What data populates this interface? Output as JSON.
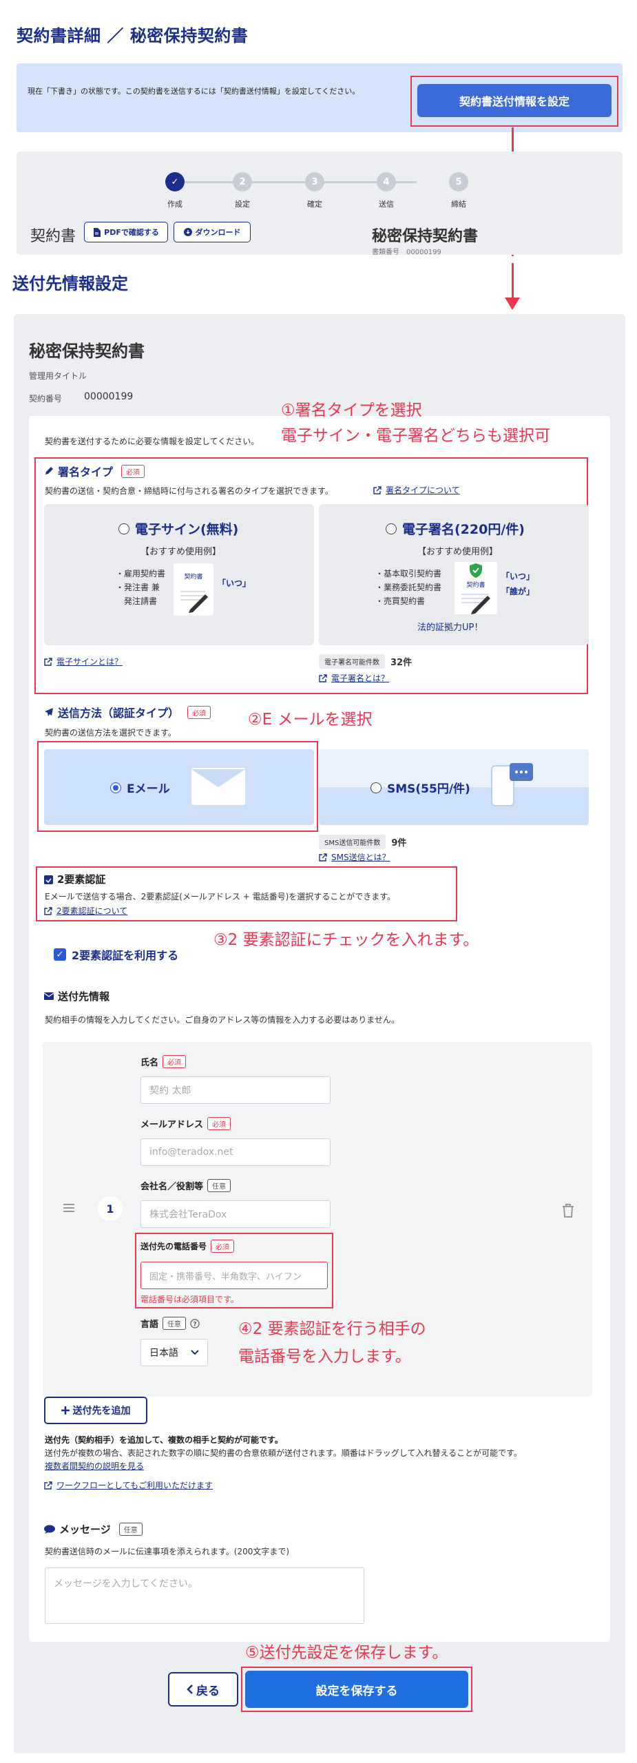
{
  "header": {
    "title": "契約書詳細 ／ 秘密保持契約書",
    "notice": "現在「下書き」の状態です。この契約書を送信するには「契約書送付情報」を設定してください。",
    "notice_button": "契約書送付情報を設定"
  },
  "progress": {
    "steps": [
      {
        "num": "✓",
        "label": "作成"
      },
      {
        "num": "2",
        "label": "設定"
      },
      {
        "num": "3",
        "label": "確定"
      },
      {
        "num": "4",
        "label": "送信"
      },
      {
        "num": "5",
        "label": "締結"
      }
    ],
    "doc_label": "契約書",
    "pdf_button": "PDFで確認する",
    "download_button": "ダウンロード",
    "doc_title": "秘密保持契約書",
    "doc_number_partial": "書類番号　00000199"
  },
  "section_title": "送付先情報設定",
  "contract": {
    "title": "秘密保持契約書",
    "mgmt_title_label": "管理用タイトル",
    "number_label": "契約番号",
    "number": "00000199",
    "intro": "契約書を送付するために必要な情報を設定してください。"
  },
  "annotations": {
    "a1_line1": "①署名タイプを選択",
    "a1_line2": "電子サイン・電子署名どちらも選択可",
    "a2": "②E メールを選択",
    "a3": "③2 要素認証にチェックを入れます。",
    "a4_line1": "④2 要素認証を行う相手の",
    "a4_line2": "電話番号を入力します。",
    "a5": "⑤送付先設定を保存します。"
  },
  "signature": {
    "title": "署名タイプ",
    "required": "必須",
    "desc": "契約書の送信・契約合意・締結時に付与される署名のタイプを選択できます。",
    "about_link": "署名タイプについて",
    "esign": {
      "title": "電子サイン(無料)",
      "rec": "【おすすめ使用例】",
      "items": [
        "・雇用契約書",
        "・発注書 兼",
        "　発注請書"
      ],
      "doc_text": "契約書",
      "when": "「いつ」",
      "link": "電子サインとは？"
    },
    "edsig": {
      "title": "電子署名(220円/件)",
      "rec": "【おすすめ使用例】",
      "items": [
        "・基本取引契約書",
        "・業務委託契約書",
        "・売買契約書"
      ],
      "doc_text": "契約書",
      "when": "「いつ」",
      "who": "「誰が」",
      "badge": "法的証拠力UP！",
      "count_label": "電子署名可能件数",
      "count": "32件",
      "link": "電子署名とは？"
    }
  },
  "send_method": {
    "title": "送信方法（認証タイプ）",
    "required": "必須",
    "desc": "契約書の送信方法を選択できます。",
    "email": "Eメール",
    "sms": "SMS(55円/件)",
    "sms_count_label": "SMS送信可能件数",
    "sms_count": "9件",
    "sms_link": "SMS送信とは？"
  },
  "two_factor": {
    "title": "2要素認証",
    "desc": "Eメールで送信する場合、2要素認証(メールアドレス + 電話番号)を選択することができます。",
    "link": "2要素認証について",
    "checkbox_label": "2要素認証を利用する"
  },
  "recipient": {
    "title": "送付先情報",
    "desc": "契約相手の情報を入力してください。ご自身のアドレス等の情報を入力する必要はありません。",
    "index": "1",
    "name_label": "氏名",
    "name_placeholder": "契約 太郎",
    "email_label": "メールアドレス",
    "email_placeholder": "info@teradox.net",
    "company_label": "会社名／役割等",
    "company_placeholder": "株式会社TeraDox",
    "phone_label": "送付先の電話番号",
    "phone_placeholder": "固定・携帯番号、半角数字、ハイフン",
    "phone_error": "電話番号は必須項目です。",
    "lang_label": "言語",
    "lang_value": "日本語",
    "required": "必須",
    "optional": "任意"
  },
  "add_recipient": {
    "button": "送付先を追加",
    "note1": "送付先（契約相手）を追加して、複数の相手と契約が可能です。",
    "note2": "送付先が複数の場合、表記された数字の順に契約書の合意依頼が送付されます。順番はドラッグして入れ替えることが可能です。",
    "link1": "複数者間契約の説明を見る",
    "link2": "ワークフローとしてもご利用いただけます"
  },
  "message": {
    "title": "メッセージ",
    "optional": "任意",
    "desc": "契約書送信時のメールに伝達事項を添えられます。(200文字まで)",
    "placeholder": "メッセージを入力してください。"
  },
  "footer": {
    "back": "戻る",
    "save": "設定を保存する"
  },
  "colors": {
    "brand_navy": "#1b2f8a",
    "primary_blue": "#3b6bd8",
    "save_blue": "#1f6fe0",
    "annotation_red": "#e8384f"
  }
}
